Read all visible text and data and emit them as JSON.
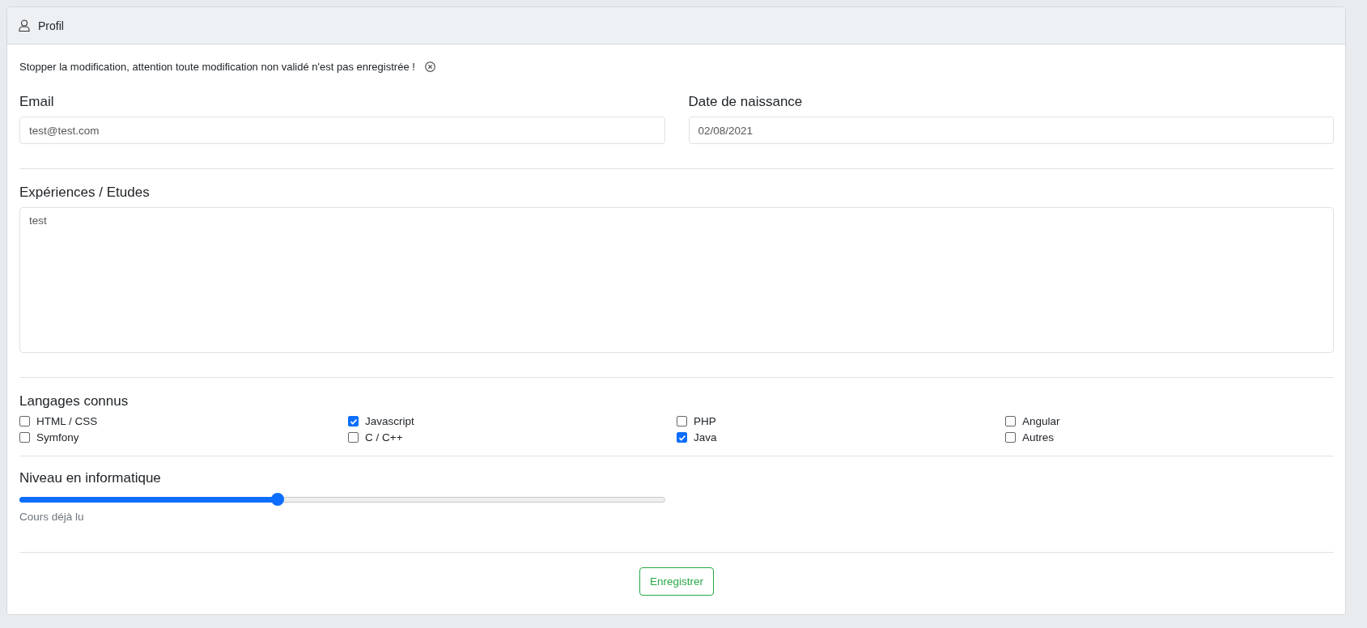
{
  "header": {
    "title": "Profil"
  },
  "notice": {
    "text": "Stopper la modification, attention toute modification non validé n'est pas enregistrée !"
  },
  "fields": [
    {
      "label": "Email",
      "value": "test@test.com"
    },
    {
      "label": "Date de naissance",
      "value": "02/08/2021"
    }
  ],
  "experience": {
    "label": "Expériences / Etudes",
    "value": "test"
  },
  "languages": {
    "label": "Langages connus",
    "items": [
      {
        "label": "HTML / CSS",
        "checked": false
      },
      {
        "label": "Javascript",
        "checked": true
      },
      {
        "label": "PHP",
        "checked": false
      },
      {
        "label": "Angular",
        "checked": false
      },
      {
        "label": "Symfony",
        "checked": false
      },
      {
        "label": "C / C++",
        "checked": false
      },
      {
        "label": "Java",
        "checked": true
      },
      {
        "label": "Autres",
        "checked": false
      }
    ]
  },
  "level": {
    "label": "Niveau en informatique",
    "level": 0.4,
    "caption": "Cours déjà lu"
  },
  "save_button": "Enregistrer"
}
